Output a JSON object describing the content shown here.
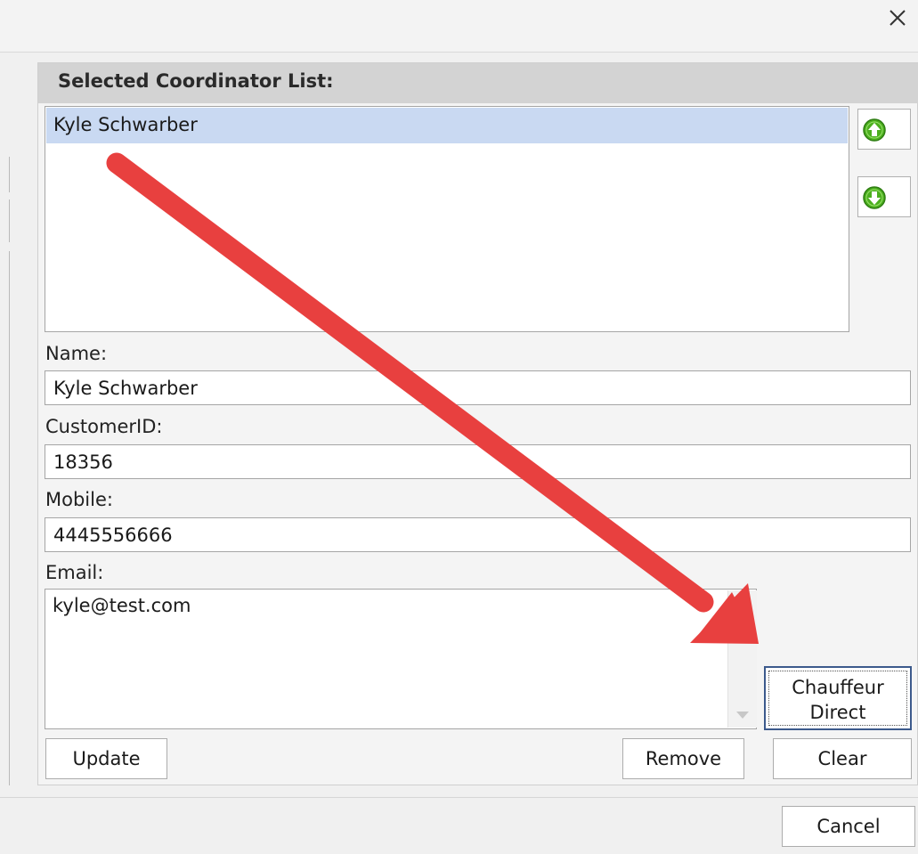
{
  "dialog": {
    "close_glyph": "✕"
  },
  "coordinator_panel": {
    "title": "Selected Coordinator List:",
    "items": [
      {
        "name": "Kyle Schwarber",
        "selected": true
      }
    ]
  },
  "form": {
    "name_label": "Name:",
    "name_value": "Kyle Schwarber",
    "customer_id_label": "CustomerID:",
    "customer_id_value": "18356",
    "mobile_label": "Mobile:",
    "mobile_value": "4445556666",
    "email_label": "Email:",
    "email_value": "kyle@test.com"
  },
  "buttons": {
    "chauffeur_line1": "Chauffeur",
    "chauffeur_line2": "Direct",
    "update": "Update",
    "remove": "Remove",
    "clear": "Clear",
    "cancel": "Cancel"
  },
  "icons": {
    "move_up": "arrow-up-circle-icon",
    "move_down": "arrow-down-circle-icon",
    "close": "close-icon"
  },
  "colors": {
    "selection": "#c9d9f2",
    "header_bg": "#d3d3d3",
    "icon_green": "#4caf1f",
    "annotation_red": "#e8403f",
    "focus_border": "#3c5a8c"
  }
}
